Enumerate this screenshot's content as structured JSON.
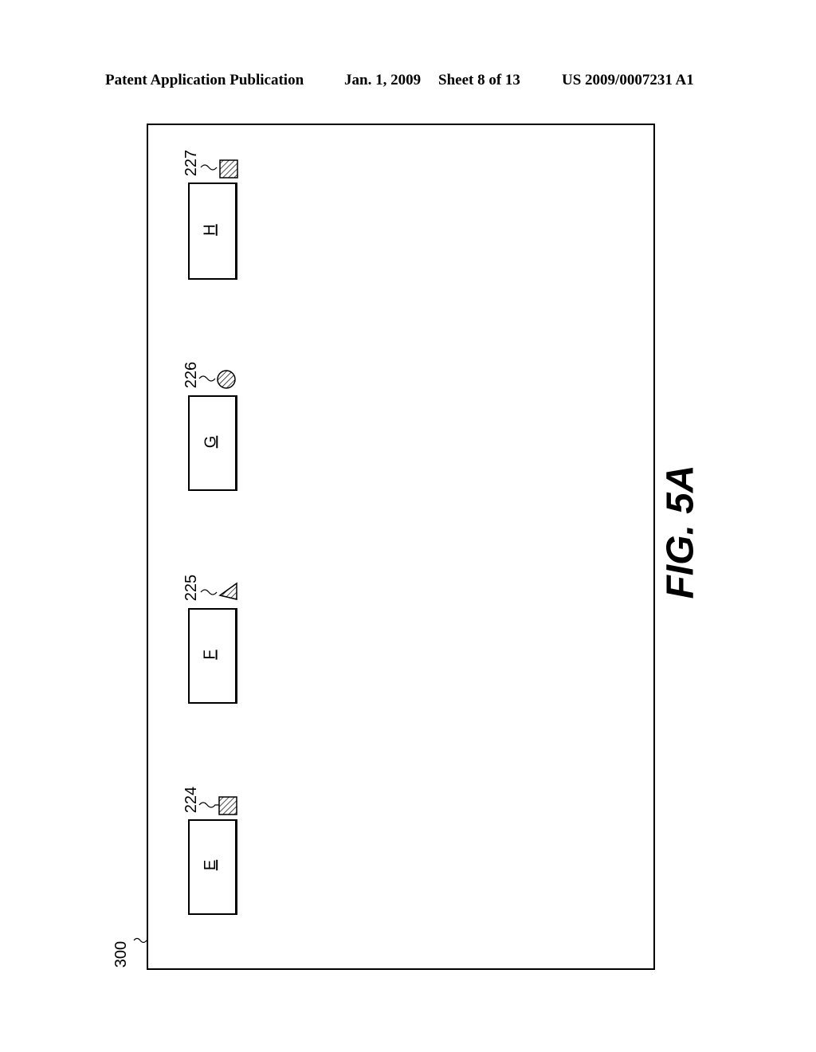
{
  "header": {
    "publication": "Patent Application Publication",
    "date": "Jan. 1, 2009",
    "sheet": "Sheet 8 of 13",
    "number": "US 2009/0007231 A1"
  },
  "figure": {
    "caption": "FIG. 5A",
    "frame_ref": "300",
    "items": [
      {
        "label": "E",
        "ref": "224",
        "icon": "hatched-square-icon"
      },
      {
        "label": "F",
        "ref": "225",
        "icon": "hatched-triangle-icon"
      },
      {
        "label": "G",
        "ref": "226",
        "icon": "hatched-circle-icon"
      },
      {
        "label": "H",
        "ref": "227",
        "icon": "hatched-square-icon"
      }
    ]
  }
}
